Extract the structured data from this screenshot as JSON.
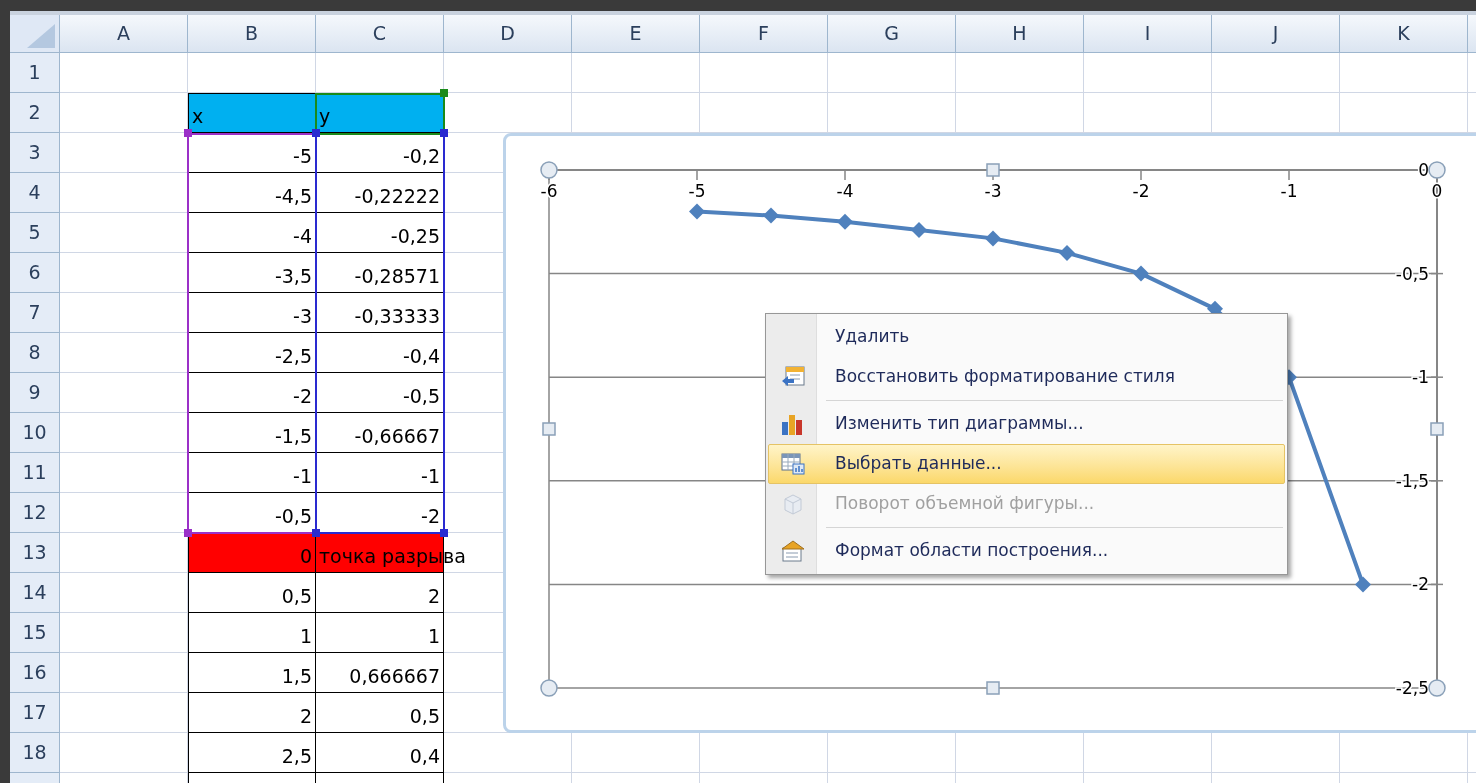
{
  "sheet": {
    "columns": [
      "A",
      "B",
      "C",
      "D",
      "E",
      "F",
      "G",
      "H",
      "I",
      "J",
      "K"
    ],
    "rows": [
      {
        "header": "1"
      },
      {
        "header": "2",
        "b": {
          "text": "x",
          "kind": "text",
          "color": "#00b0f0"
        },
        "c": {
          "text": "y",
          "kind": "text",
          "color": "#00b0f0"
        }
      },
      {
        "header": "3",
        "b": {
          "text": "-5",
          "kind": "number"
        },
        "c": {
          "text": "-0,2",
          "kind": "number"
        }
      },
      {
        "header": "4",
        "b": {
          "text": "-4,5",
          "kind": "number"
        },
        "c": {
          "text": "-0,22222",
          "kind": "number"
        }
      },
      {
        "header": "5",
        "b": {
          "text": "-4",
          "kind": "number"
        },
        "c": {
          "text": "-0,25",
          "kind": "number"
        }
      },
      {
        "header": "6",
        "b": {
          "text": "-3,5",
          "kind": "number"
        },
        "c": {
          "text": "-0,28571",
          "kind": "number"
        }
      },
      {
        "header": "7",
        "b": {
          "text": "-3",
          "kind": "number"
        },
        "c": {
          "text": "-0,33333",
          "kind": "number"
        }
      },
      {
        "header": "8",
        "b": {
          "text": "-2,5",
          "kind": "number"
        },
        "c": {
          "text": "-0,4",
          "kind": "number"
        }
      },
      {
        "header": "9",
        "b": {
          "text": "-2",
          "kind": "number"
        },
        "c": {
          "text": "-0,5",
          "kind": "number"
        }
      },
      {
        "header": "10",
        "b": {
          "text": "-1,5",
          "kind": "number"
        },
        "c": {
          "text": "-0,66667",
          "kind": "number"
        }
      },
      {
        "header": "11",
        "b": {
          "text": "-1",
          "kind": "number"
        },
        "c": {
          "text": "-1",
          "kind": "number"
        }
      },
      {
        "header": "12",
        "b": {
          "text": "-0,5",
          "kind": "number"
        },
        "c": {
          "text": "-2",
          "kind": "number"
        }
      },
      {
        "header": "13",
        "b": {
          "text": "0",
          "kind": "number",
          "color": "#ff0000"
        },
        "c": {
          "text": "точка разрыва",
          "kind": "text",
          "color": "#ff0000"
        }
      },
      {
        "header": "14",
        "b": {
          "text": "0,5",
          "kind": "number"
        },
        "c": {
          "text": "2",
          "kind": "number"
        }
      },
      {
        "header": "15",
        "b": {
          "text": "1",
          "kind": "number"
        },
        "c": {
          "text": "1",
          "kind": "number"
        }
      },
      {
        "header": "16",
        "b": {
          "text": "1,5",
          "kind": "number"
        },
        "c": {
          "text": "0,666667",
          "kind": "number"
        }
      },
      {
        "header": "17",
        "b": {
          "text": "2",
          "kind": "number"
        },
        "c": {
          "text": "0,5",
          "kind": "number"
        }
      },
      {
        "header": "18",
        "b": {
          "text": "2,5",
          "kind": "number"
        },
        "c": {
          "text": "0,4",
          "kind": "number"
        }
      }
    ]
  },
  "chart": {
    "chart_data": {
      "type": "line",
      "x": [
        -5,
        -4.5,
        -4,
        -3.5,
        -3,
        -2.5,
        -2,
        -1.5,
        -1,
        -0.5
      ],
      "series": [
        {
          "color": "#4f81bd",
          "marker": true,
          "values": [
            -0.2,
            -0.22,
            -0.25,
            -0.29,
            -0.33,
            -0.4,
            -0.5,
            -0.67,
            -1,
            -2
          ]
        }
      ],
      "grid": true,
      "xlim": [
        -6,
        0
      ],
      "ylim": [
        -2.5,
        0
      ],
      "xticks": [
        {
          "value": -6,
          "label": "-6"
        },
        {
          "value": -5,
          "label": "-5"
        },
        {
          "value": -4,
          "label": "-4"
        },
        {
          "value": -3,
          "label": "-3"
        },
        {
          "value": -2,
          "label": "-2"
        },
        {
          "value": -1,
          "label": "-1"
        },
        {
          "value": 0,
          "label": "0"
        }
      ],
      "yticks": [
        {
          "value": 0,
          "label": "0"
        },
        {
          "value": -0.5,
          "label": "-0,5"
        },
        {
          "value": -1,
          "label": "-1"
        },
        {
          "value": -1.5,
          "label": "-1,5"
        },
        {
          "value": -2,
          "label": "-2"
        },
        {
          "value": -2.5,
          "label": "-2,5"
        }
      ]
    }
  },
  "context_menu": {
    "items": [
      {
        "label": "Удалить",
        "selected": false,
        "disabled": false
      },
      {
        "label": "Восстановить форматирование стиля",
        "selected": false,
        "disabled": false
      },
      {
        "label": "Изменить тип диаграммы...",
        "selected": false,
        "disabled": false
      },
      {
        "label": "Выбрать данные...",
        "selected": true,
        "disabled": false
      },
      {
        "label": "Поворот объемной фигуры...",
        "selected": false,
        "disabled": true
      },
      {
        "label": "Формат области построения...",
        "selected": false,
        "disabled": false
      }
    ]
  }
}
